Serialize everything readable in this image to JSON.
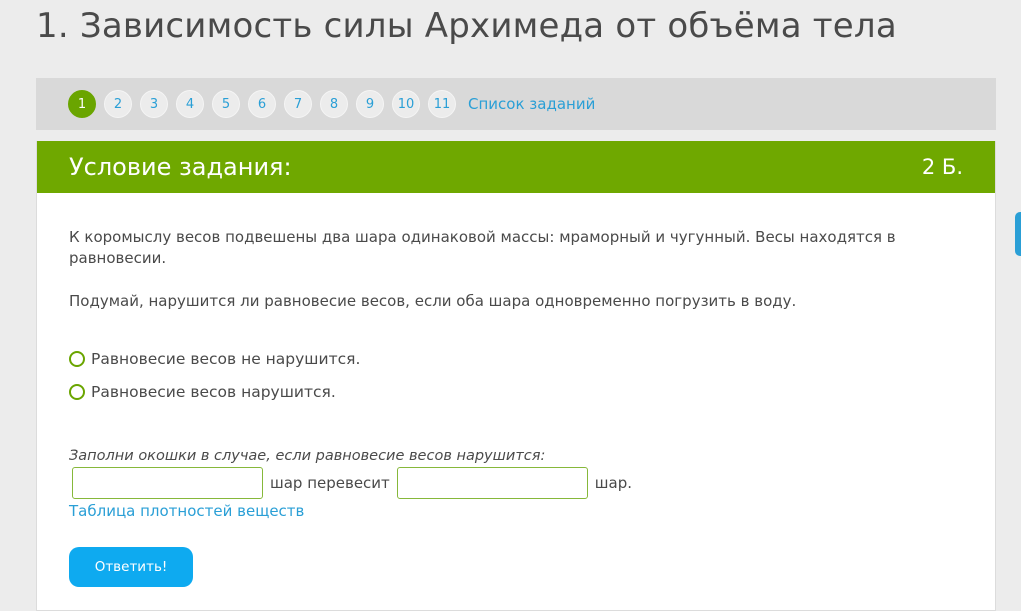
{
  "page": {
    "title": "1. Зависимость силы Архимеда от объёма тела"
  },
  "pager": {
    "items": [
      "1",
      "2",
      "3",
      "4",
      "5",
      "6",
      "7",
      "8",
      "9",
      "10",
      "11"
    ],
    "active_index": 0,
    "list_link": "Список заданий"
  },
  "task": {
    "header": "Условие задания:",
    "points": "2 Б.",
    "paragraph_1": "К коромыслу весов подвешены два шара одинаковой массы: мраморный и чугунный. Весы находятся в равновесии.",
    "paragraph_2": "Подумай, нарушится ли равновесие весов, если оба шара одновременно погрузить в воду.",
    "options": [
      "Равновесие весов не нарушится.",
      "Равновесие весов нарушится."
    ],
    "fill_prompt": "Заполни окошки в случае, если равновесие весов нарушится:",
    "fill_text_1": "шар перевесит",
    "fill_text_2": "шар.",
    "input_1_value": "",
    "input_2_value": "",
    "density_link": "Таблица плотностей веществ",
    "submit_label": "Ответить!"
  },
  "colors": {
    "accent_green": "#6fa800",
    "link_blue": "#2a9fd6",
    "button_blue": "#0eaaf0"
  }
}
